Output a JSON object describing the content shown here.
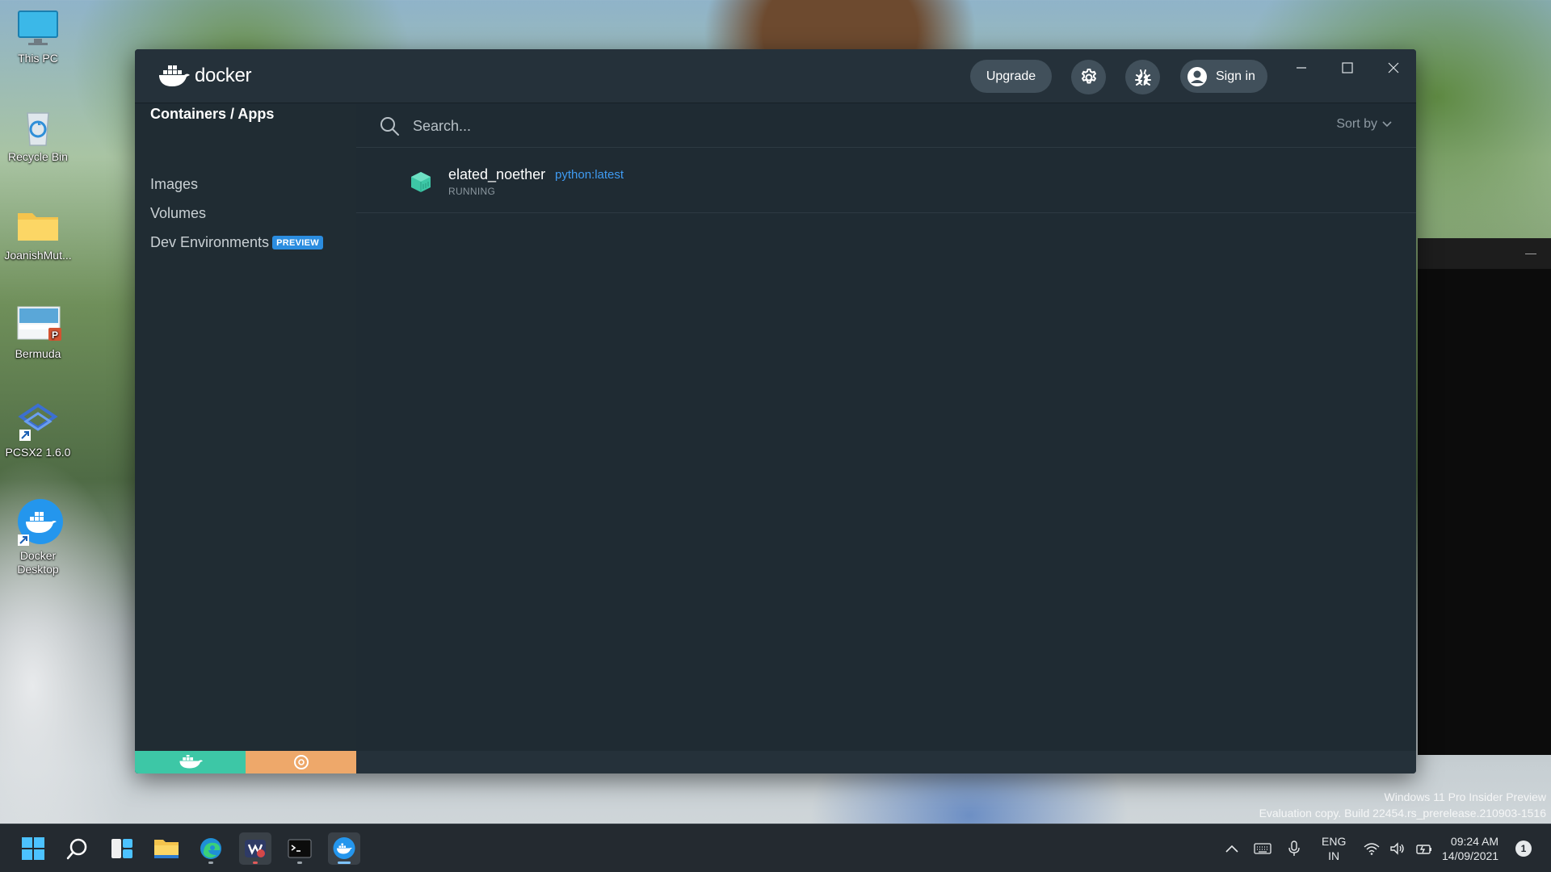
{
  "desktop": {
    "icons": [
      {
        "label": "This PC"
      },
      {
        "label": "Recycle Bin"
      },
      {
        "label": "JoanishMut..."
      },
      {
        "label": "Bermuda"
      },
      {
        "label": "PCSX2 1.6.0"
      },
      {
        "label": "Docker Desktop"
      }
    ],
    "watermark_line1": "Windows 11 Pro Insider Preview",
    "watermark_line2": "Evaluation copy. Build 22454.rs_prerelease.210903-1516"
  },
  "window": {
    "logo_text": "docker",
    "upgrade_label": "Upgrade",
    "signin_label": "Sign in"
  },
  "sidebar": {
    "items": [
      {
        "label": "Containers / Apps",
        "active": true
      },
      {
        "label": "Images"
      },
      {
        "label": "Volumes"
      },
      {
        "label": "Dev Environments",
        "badge": "PREVIEW"
      }
    ]
  },
  "search": {
    "placeholder": "Search...",
    "sort_label": "Sort by"
  },
  "containers": [
    {
      "name": "elated_noether",
      "image": "python:latest",
      "status": "RUNNING"
    }
  ],
  "taskbar": {
    "lang_line1": "ENG",
    "lang_line2": "IN",
    "time": "09:24 AM",
    "date": "14/09/2021",
    "notification_count": "1"
  },
  "colors": {
    "accent": "#2b8de0",
    "engine_running": "#3dc7a6",
    "update_available": "#eea86a",
    "container_running": "#3dc7a6"
  }
}
